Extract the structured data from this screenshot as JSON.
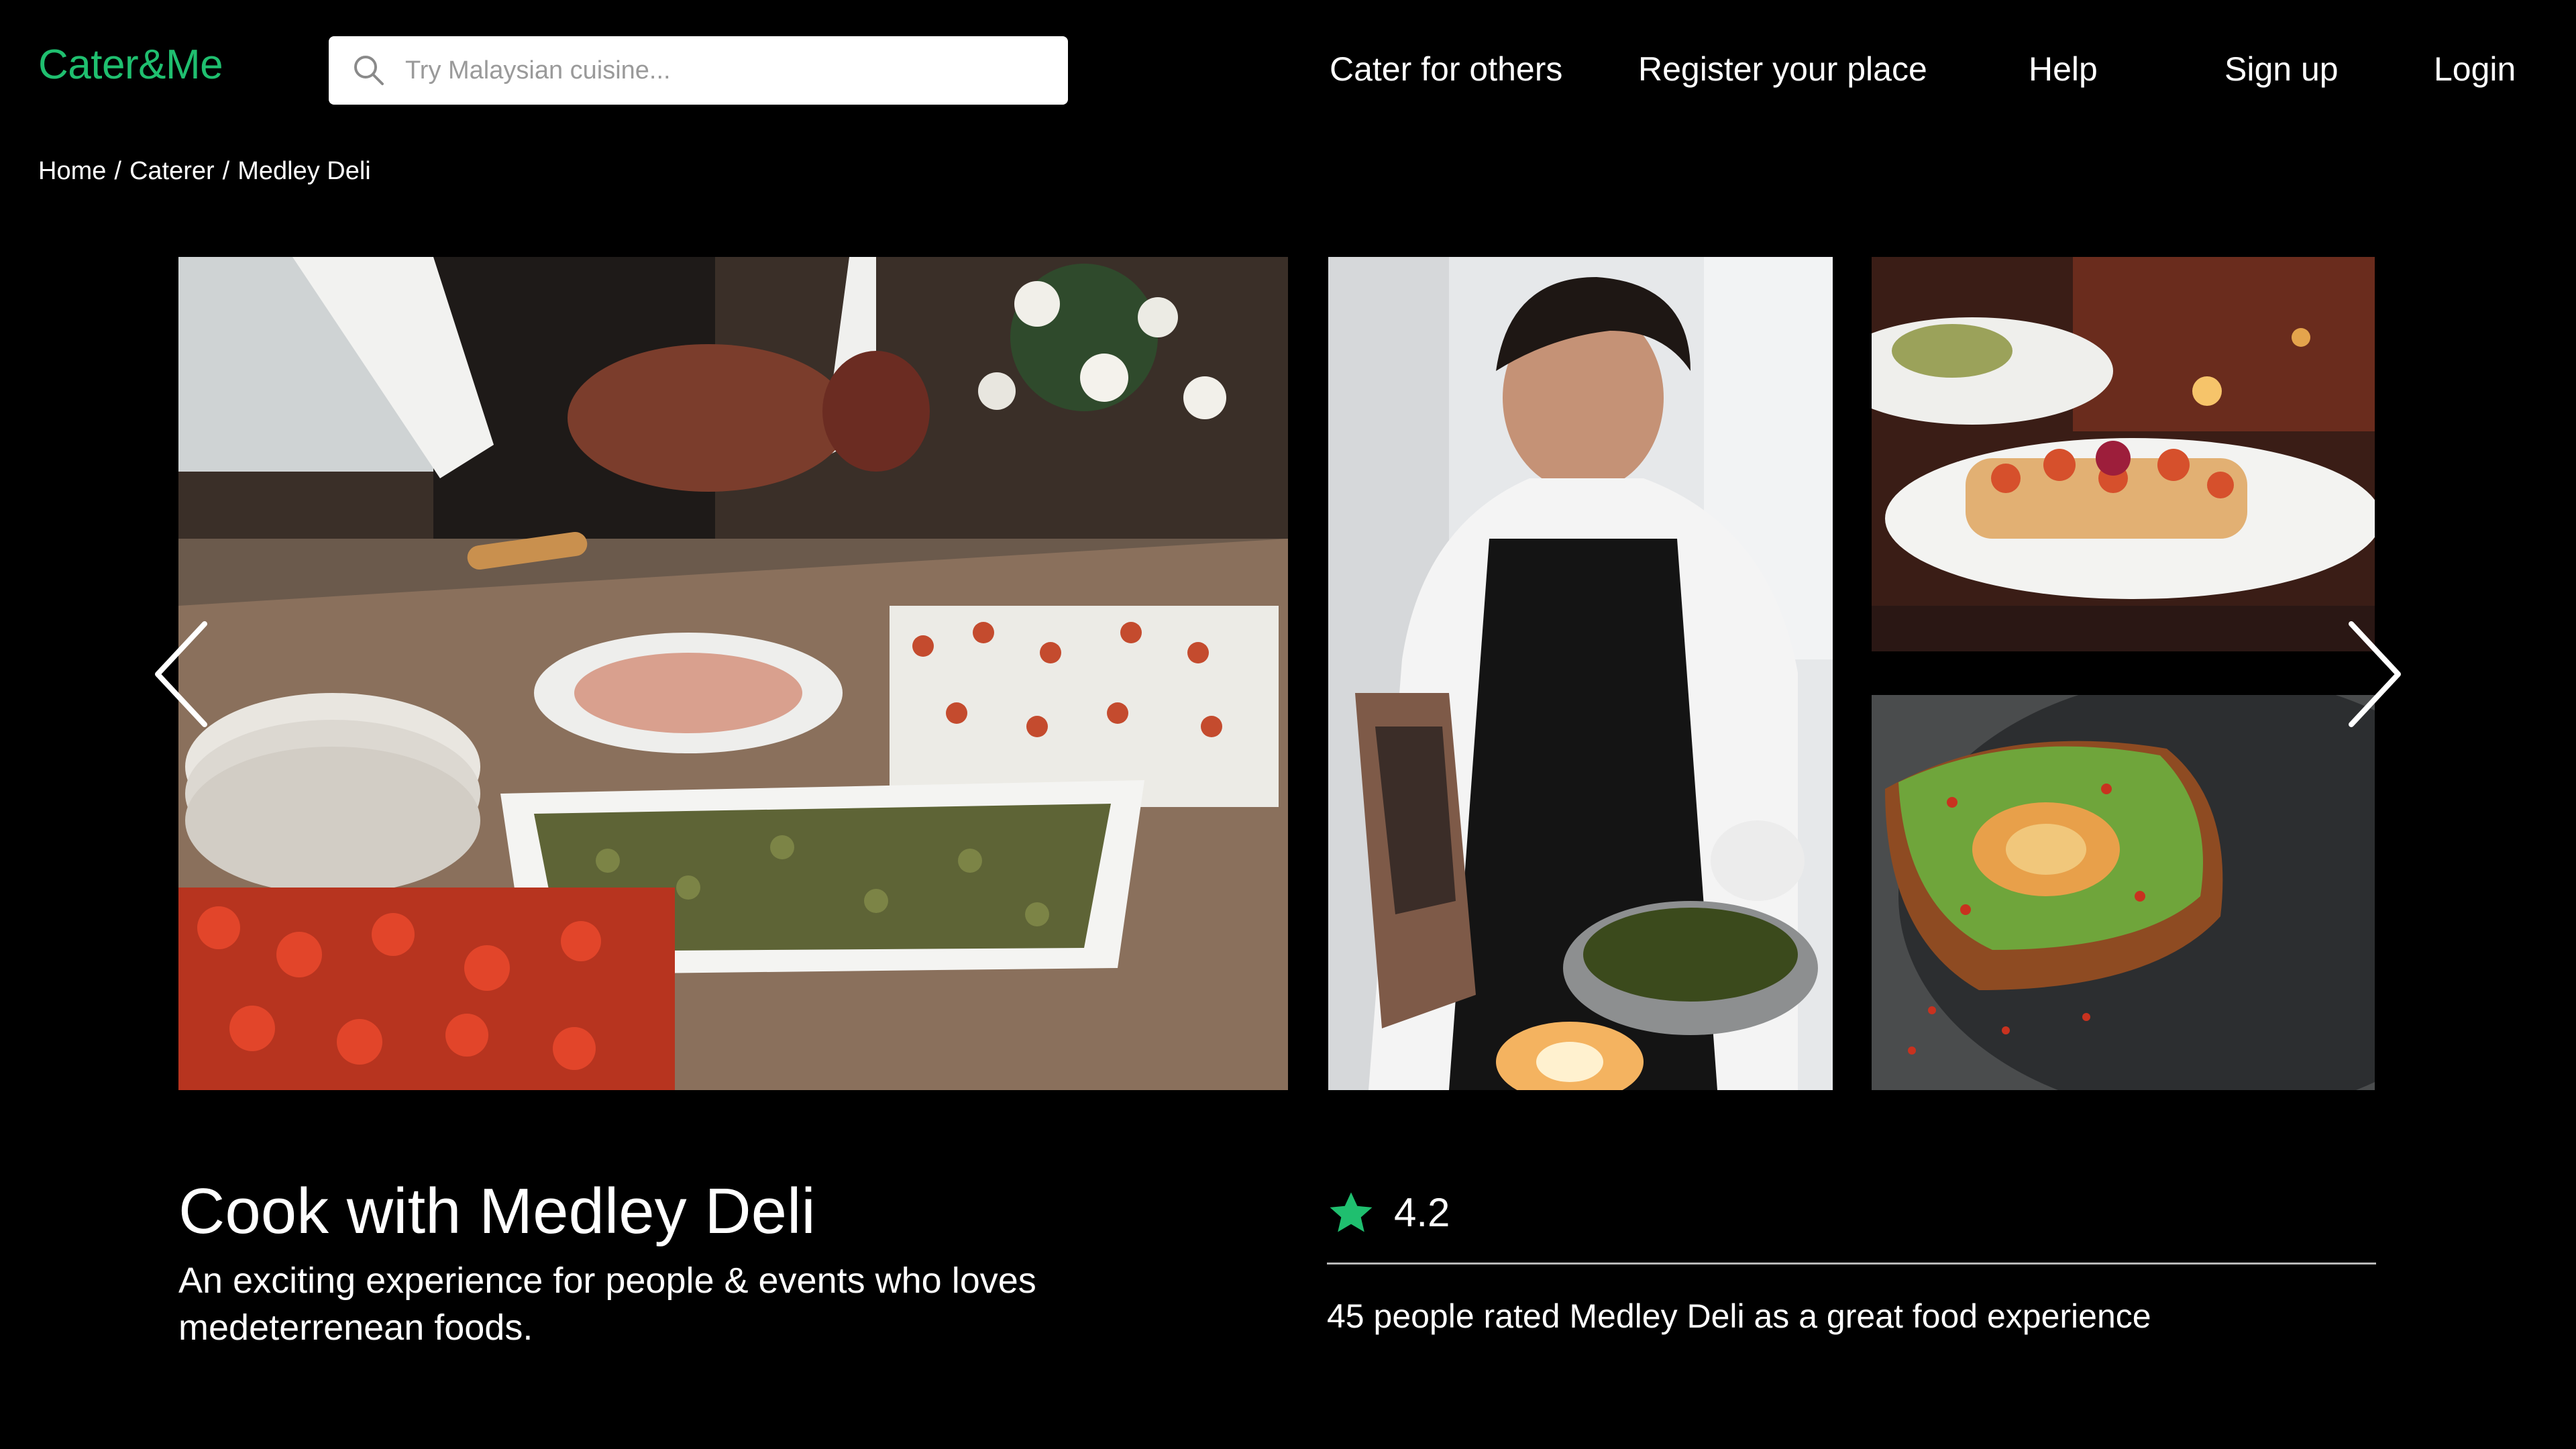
{
  "header": {
    "logo": "Cater&Me",
    "search_placeholder": "Try Malaysian cuisine...",
    "search_value": "",
    "nav": [
      {
        "label": "Cater for others"
      },
      {
        "label": "Register your place"
      },
      {
        "label": "Help"
      },
      {
        "label": "Sign up"
      },
      {
        "label": "Login"
      }
    ]
  },
  "breadcrumb": {
    "items": [
      "Home",
      "Caterer",
      "Medley Deli"
    ],
    "separator": "/"
  },
  "gallery": {
    "icons": {
      "prev": "chevron-left-icon",
      "next": "chevron-right-icon"
    }
  },
  "listing": {
    "title": "Cook with Medley Deli",
    "description": "An exciting experience for people & events who loves medeterrenean foods."
  },
  "rating": {
    "value": "4.2",
    "icon": "star-icon",
    "summary": "45 people rated Medley Deli as a great food experience"
  },
  "colors": {
    "brand": "#1fbf6f",
    "background": "#000000",
    "text": "#ffffff"
  }
}
